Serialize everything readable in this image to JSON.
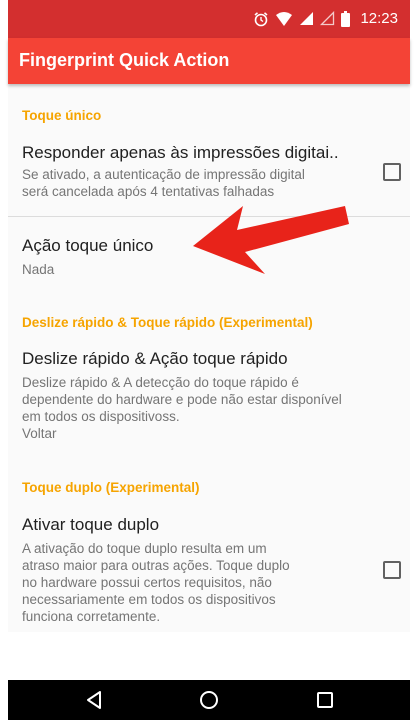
{
  "status_bar": {
    "time": "12:23",
    "icons": [
      "alarm-icon",
      "wifi-icon",
      "signal-icon",
      "signal-empty-icon",
      "battery-icon"
    ]
  },
  "app_bar": {
    "title": "Fingerprint Quick Action"
  },
  "sections": [
    {
      "header": "Toque único",
      "items": [
        {
          "title": "Responder apenas às impressões digitai..",
          "summary_lines": [
            "Se ativado, a autenticação de impressão digital",
            "será cancelada após 4 tentativas falhadas"
          ],
          "checked": false
        },
        {
          "title": "Ação toque único",
          "summary_lines": [
            "Nada"
          ]
        }
      ]
    },
    {
      "header": "Deslize rápido & Toque rápido (Experimental)",
      "items": [
        {
          "title": "Deslize rápido & Ação toque rápido",
          "summary_lines": [
            "Deslize rápido & A detecção do toque rápido é",
            "dependente do hardware e pode não estar disponível",
            "em todos os dispositivoss.",
            "Voltar"
          ]
        }
      ]
    },
    {
      "header": "Toque duplo (Experimental)",
      "items": [
        {
          "title": "Ativar toque duplo",
          "summary_lines": [
            "A ativação do toque duplo resulta em um",
            "atraso maior para outras ações. Toque duplo",
            "no hardware possui certos requisitos, não",
            "necessariamente em todos os dispositivos",
            "funciona corretamente."
          ],
          "checked": false
        }
      ]
    }
  ],
  "nav_bar": {
    "buttons": [
      "back-icon",
      "home-icon",
      "recents-icon"
    ]
  },
  "colors": {
    "status_bar": "#d32f2f",
    "app_bar": "#f44336",
    "section_header": "#f6a400",
    "arrow": "#e8231a"
  }
}
